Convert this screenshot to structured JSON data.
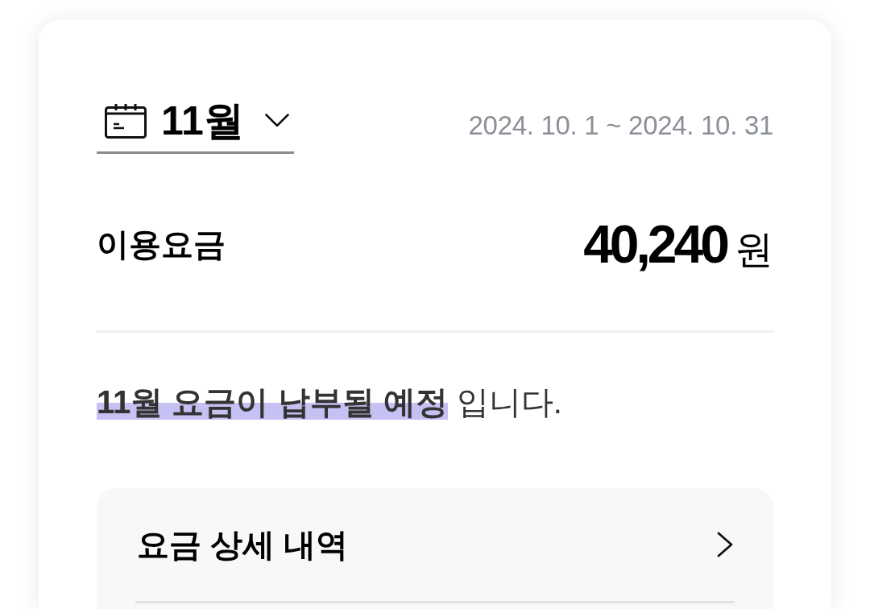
{
  "month_selector": {
    "label": "11월"
  },
  "period": "2024. 10. 1 ~ 2024. 10. 31",
  "fee": {
    "label": "이용요금",
    "amount": "40,240",
    "unit": "원"
  },
  "notice": "**11월 요금이 납부될 예정** 입니다.",
  "detail_link": {
    "label": "요금 상세 내역"
  }
}
